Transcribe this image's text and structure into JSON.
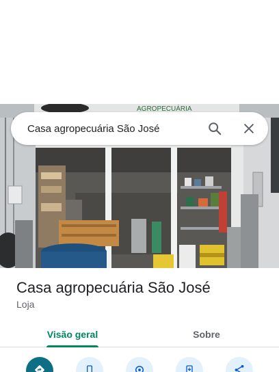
{
  "search": {
    "query": "Casa agropecuária São José",
    "search_icon": "search-icon",
    "close_icon": "close-icon"
  },
  "photo": {
    "sign_text": "AGROPECUÁRIA"
  },
  "place": {
    "name": "Casa agropecuária São José",
    "category": "Loja"
  },
  "tabs": [
    {
      "label": "Visão geral",
      "active": true
    },
    {
      "label": "Sobre",
      "active": false
    }
  ],
  "actions": [
    {
      "icon": "directions-icon"
    },
    {
      "icon": "phone-icon"
    },
    {
      "icon": "location-pin-icon"
    },
    {
      "icon": "save-to-phone-icon"
    },
    {
      "icon": "share-icon"
    }
  ],
  "colors": {
    "accent": "#01875f",
    "primary_action": "#0d6e84",
    "action_bg": "#e2f1fb",
    "text_primary": "#202124",
    "text_secondary": "#5f6368"
  }
}
